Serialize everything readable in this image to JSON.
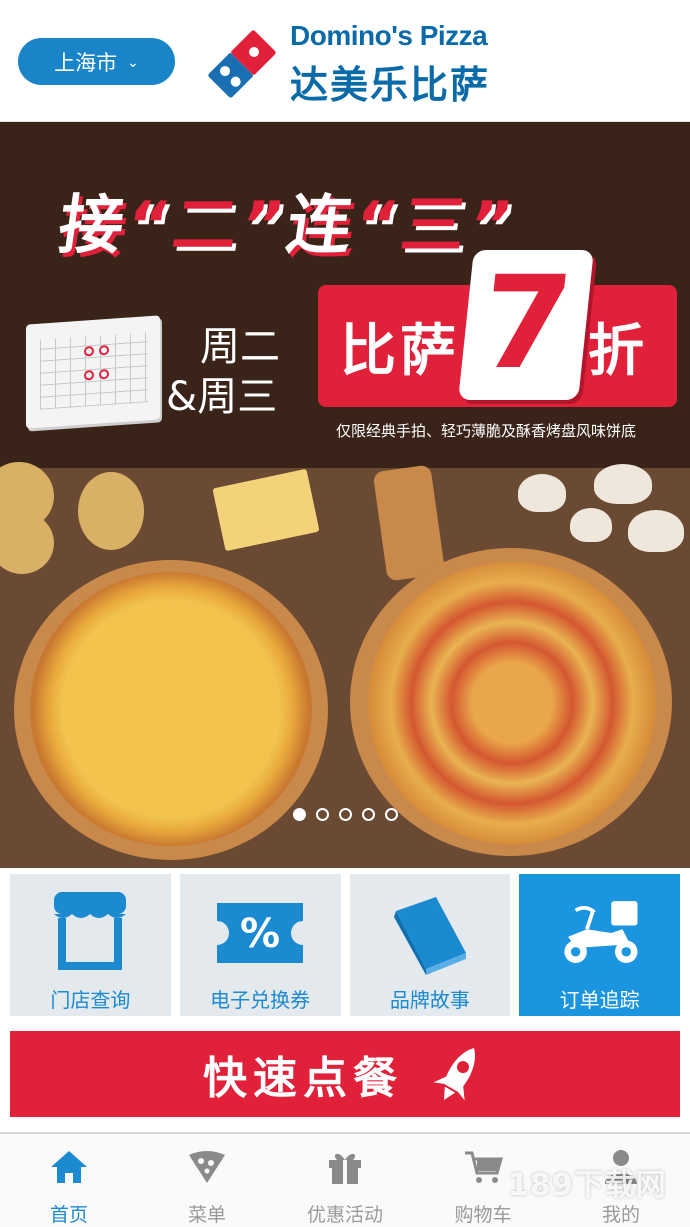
{
  "header": {
    "city_label": "上海市",
    "brand_en": "Domino's Pizza",
    "brand_cn": "达美乐比萨"
  },
  "banner": {
    "headline_parts": [
      "接",
      "“二”",
      "连",
      "“三”"
    ],
    "days_line1": "周二",
    "days_line2": "&周三",
    "discount_label": "比萨",
    "discount_number": "7",
    "discount_unit": "折",
    "fine_print": "仅限经典手拍、轻巧薄脆及酥香烤盘风味饼底",
    "slide_count": 5,
    "active_slide": 1
  },
  "tiles": [
    {
      "label": "门店查询",
      "icon": "store-icon",
      "active": false
    },
    {
      "label": "电子兑换券",
      "icon": "coupon-icon",
      "active": false
    },
    {
      "label": "品牌故事",
      "icon": "book-icon",
      "active": false
    },
    {
      "label": "订单追踪",
      "icon": "delivery-scooter-icon",
      "active": true
    }
  ],
  "quick_order": {
    "label": "快速点餐",
    "icon": "rocket-icon"
  },
  "bottom_nav": [
    {
      "label": "首页",
      "icon": "home-icon",
      "active": true
    },
    {
      "label": "菜单",
      "icon": "pizza-slice-icon",
      "active": false
    },
    {
      "label": "优惠活动",
      "icon": "gift-icon",
      "active": false
    },
    {
      "label": "购物车",
      "icon": "cart-icon",
      "active": false
    },
    {
      "label": "我的",
      "icon": "user-icon",
      "active": false
    }
  ],
  "watermark": "189下载网",
  "colors": {
    "brand_blue": "#0b6aa8",
    "accent_blue": "#1b8ad1",
    "brand_red": "#e1203a",
    "tile_bg": "#e4e9ee"
  }
}
